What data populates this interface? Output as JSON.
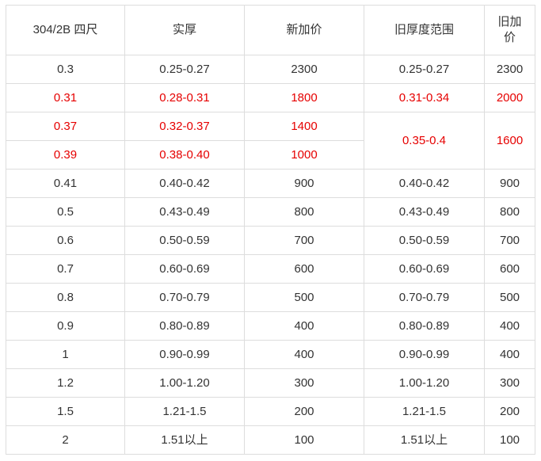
{
  "table": {
    "headers": [
      "304/2B 四尺",
      "实厚",
      "新加价",
      "旧厚度范围",
      "旧加价"
    ],
    "rows": [
      {
        "nominal": "0.3",
        "actual": "0.25-0.27",
        "new_price": "2300",
        "old_range": "0.25-0.27",
        "old_price": "2300",
        "highlight": false
      },
      {
        "nominal": "0.31",
        "actual": "0.28-0.31",
        "new_price": "1800",
        "old_range": "0.31-0.34",
        "old_price": "2000",
        "highlight": true
      },
      {
        "nominal": "0.37",
        "actual": "0.32-0.37",
        "new_price": "1400",
        "old_range": "0.35-0.4",
        "old_price": "1600",
        "highlight": true
      },
      {
        "nominal": "0.39",
        "actual": "0.38-0.40",
        "new_price": "1000",
        "highlight": true
      },
      {
        "nominal": "0.41",
        "actual": "0.40-0.42",
        "new_price": "900",
        "old_range": "0.40-0.42",
        "old_price": "900",
        "highlight": false
      },
      {
        "nominal": "0.5",
        "actual": "0.43-0.49",
        "new_price": "800",
        "old_range": "0.43-0.49",
        "old_price": "800",
        "highlight": false
      },
      {
        "nominal": "0.6",
        "actual": "0.50-0.59",
        "new_price": "700",
        "old_range": "0.50-0.59",
        "old_price": "700",
        "highlight": false
      },
      {
        "nominal": "0.7",
        "actual": "0.60-0.69",
        "new_price": "600",
        "old_range": "0.60-0.69",
        "old_price": "600",
        "highlight": false
      },
      {
        "nominal": "0.8",
        "actual": "0.70-0.79",
        "new_price": "500",
        "old_range": "0.70-0.79",
        "old_price": "500",
        "highlight": false
      },
      {
        "nominal": "0.9",
        "actual": "0.80-0.89",
        "new_price": "400",
        "old_range": "0.80-0.89",
        "old_price": "400",
        "highlight": false
      },
      {
        "nominal": "1",
        "actual": "0.90-0.99",
        "new_price": "400",
        "old_range": "0.90-0.99",
        "old_price": "400",
        "highlight": false
      },
      {
        "nominal": "1.2",
        "actual": "1.00-1.20",
        "new_price": "300",
        "old_range": "1.00-1.20",
        "old_price": "300",
        "highlight": false
      },
      {
        "nominal": "1.5",
        "actual": "1.21-1.5",
        "new_price": "200",
        "old_range": "1.21-1.5",
        "old_price": "200",
        "highlight": false
      },
      {
        "nominal": "2",
        "actual": "1.51以上",
        "new_price": "100",
        "old_range": "1.51以上",
        "old_price": "100",
        "highlight": false
      }
    ]
  },
  "colors": {
    "highlight_text": "#e60000",
    "normal_text": "#333333",
    "border": "#dddddd"
  }
}
